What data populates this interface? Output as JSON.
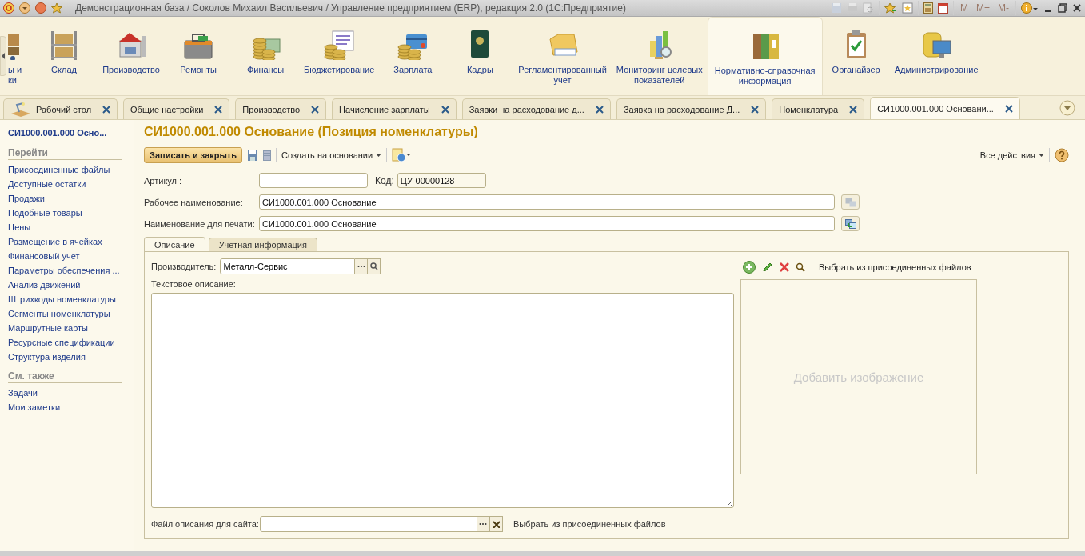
{
  "window": {
    "title": "Демонстрационная база / Соколов Михаил Васильевич / Управление предприятием (ERP), редакция 2.0  (1С:Предприятие)",
    "memory_keys": [
      {
        "label": "M",
        "disabled": true
      },
      {
        "label": "M+",
        "disabled": true
      },
      {
        "label": "M-",
        "disabled": true
      }
    ]
  },
  "sections": [
    {
      "label": "ы и\nки",
      "selected": false
    },
    {
      "label": "Склад",
      "selected": false
    },
    {
      "label": "Производство",
      "selected": false
    },
    {
      "label": "Ремонты",
      "selected": false
    },
    {
      "label": "Финансы",
      "selected": false
    },
    {
      "label": "Бюджетирование",
      "selected": false
    },
    {
      "label": "Зарплата",
      "selected": false
    },
    {
      "label": "Кадры",
      "selected": false
    },
    {
      "label": "Регламентированный\nучет",
      "selected": false
    },
    {
      "label": "Мониторинг целевых\nпоказателей",
      "selected": false
    },
    {
      "label": "Нормативно-справочная\nинформация",
      "selected": true
    },
    {
      "label": "Органайзер",
      "selected": false
    },
    {
      "label": "Администрирование",
      "selected": false
    }
  ],
  "open_tabs": [
    {
      "label": "Рабочий стол",
      "selected": false
    },
    {
      "label": "Общие настройки",
      "selected": false
    },
    {
      "label": "Производство",
      "selected": false
    },
    {
      "label": "Начисление зарплаты",
      "selected": false
    },
    {
      "label": "Заявки на расходование д...",
      "selected": false
    },
    {
      "label": "Заявка на расходование Д...",
      "selected": false
    },
    {
      "label": "Номенклатура",
      "selected": false
    },
    {
      "label": "СИ1000.001.000 Основани...",
      "selected": true
    }
  ],
  "sidebar": {
    "title": "СИ1000.001.000 Осно...",
    "groups": [
      {
        "heading": "Перейти",
        "items": [
          "Присоединенные файлы",
          "Доступные остатки",
          "Продажи",
          "Подобные товары",
          "Цены",
          "Размещение в ячейках",
          "Финансовый учет",
          "Параметры обеспечения ...",
          "Анализ движений",
          "Штрихкоды номенклатуры",
          "Сегменты номенклатуры",
          "Маршрутные карты",
          "Ресурсные спецификации",
          "Структура изделия"
        ]
      },
      {
        "heading": "См. также",
        "items": [
          "Задачи",
          "Мои заметки"
        ]
      }
    ]
  },
  "form": {
    "title": "СИ1000.001.000 Основание (Позиция номенклатуры)",
    "toolbar": {
      "save_and_close": "Записать и закрыть",
      "create_based_on": "Создать на основании",
      "all_actions": "Все действия"
    },
    "article": {
      "label": "Артикул :"
    },
    "code": {
      "label": "Код:",
      "value": "ЦУ-00000128"
    },
    "working_name": {
      "label": "Рабочее наименование:",
      "value": "СИ1000.001.000 Основание"
    },
    "print_name": {
      "label": "Наименование для печати:",
      "value": "СИ1000.001.000 Основание"
    },
    "tabs": [
      {
        "label": "Описание",
        "selected": true
      },
      {
        "label": "Учетная информация",
        "selected": false
      }
    ],
    "manufacturer": {
      "label": "Производитель:",
      "value": "Металл-Сервис"
    },
    "text_description": {
      "label": "Текстовое описание:"
    },
    "image": {
      "pick_link": "Выбрать из присоединенных файлов",
      "placeholder": "Добавить изображение"
    },
    "site_file": {
      "label": "Файл описания для сайта:",
      "pick_link": "Выбрать из присоединенных файлов"
    }
  }
}
